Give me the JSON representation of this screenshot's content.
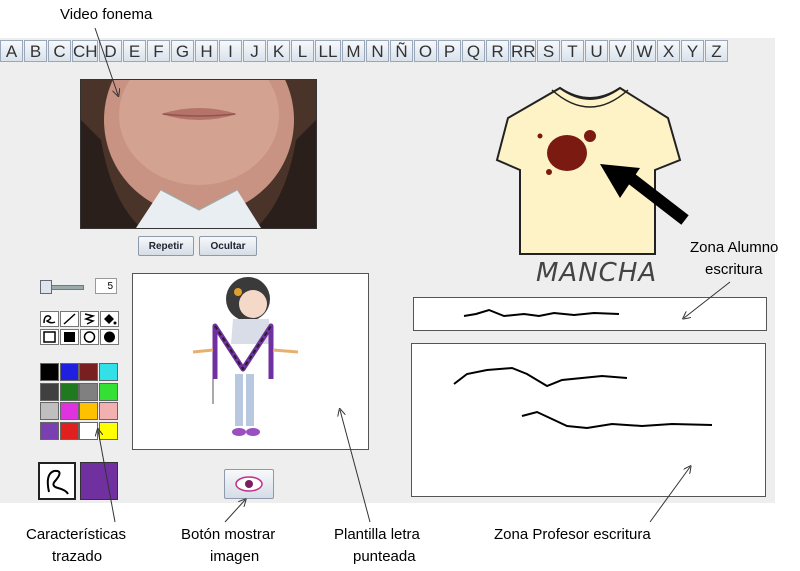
{
  "alphabet": [
    "A",
    "B",
    "C",
    "CH",
    "D",
    "E",
    "F",
    "G",
    "H",
    "I",
    "J",
    "K",
    "L",
    "LL",
    "M",
    "N",
    "Ñ",
    "O",
    "P",
    "Q",
    "R",
    "RR",
    "S",
    "T",
    "U",
    "V",
    "W",
    "X",
    "Y",
    "Z"
  ],
  "buttons": {
    "repeat": "Repetir",
    "hide": "Ocultar"
  },
  "stroke_size": "5",
  "word": "MANCHA",
  "callouts": {
    "video": "Video fonema",
    "student_zone_1": "Zona Alumno",
    "student_zone_2": "escritura",
    "stroke_1": "Características",
    "stroke_2": "trazado",
    "show_image_1": "Botón mostrar",
    "show_image_2": "imagen",
    "template_1": "Plantilla letra",
    "template_2": "punteada",
    "teacher_zone": "Zona Profesor escritura"
  },
  "palette": [
    "#000000",
    "#1f1fe0",
    "#7a1f1f",
    "#33e0e8",
    "#404040",
    "#1f7a1f",
    "#808080",
    "#33e033",
    "#bfbfbf",
    "#e033e0",
    "#ffc000",
    "#f2b0b0",
    "#7a3fb0",
    "#e01f1f",
    "#ffffff",
    "#ffff00"
  ],
  "selected_color": "#7030a0",
  "tools": [
    "freehand-tool",
    "line-tool",
    "zigzag-tool",
    "fill-tool",
    "rect-outline-tool",
    "rect-fill-tool",
    "circle-outline-tool",
    "circle-fill-tool"
  ]
}
